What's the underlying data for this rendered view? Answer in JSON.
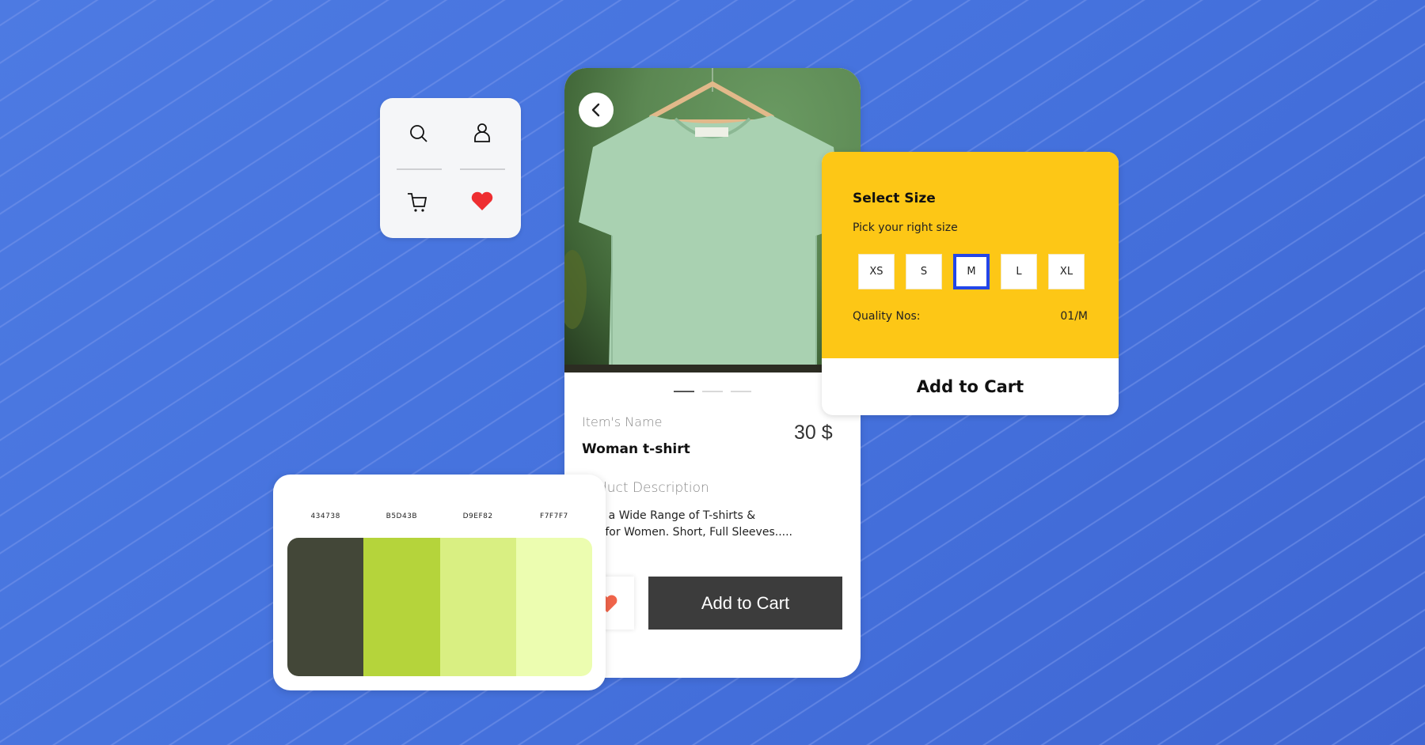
{
  "icon_card": {
    "icons": [
      {
        "name": "search-icon"
      },
      {
        "name": "user-icon"
      },
      {
        "name": "cart-icon"
      },
      {
        "name": "heart-icon",
        "color": "#ee2e31"
      }
    ]
  },
  "product_card": {
    "carousel": {
      "count": 3,
      "active": 1
    },
    "item_label": "Item's Name",
    "item_name": "Woman t-shirt",
    "price": "30 $",
    "description_label": "Product Description",
    "description_line1": "Shop a Wide Range of T-shirts &",
    "description_line2": "Tops for Women. Short, Full Sleeves.....",
    "favorite_color": "#f0644a",
    "add_to_cart": "Add to Cart"
  },
  "size_card": {
    "title": "Select Size",
    "subtitle": "Pick your right size",
    "sizes": [
      "XS",
      "S",
      "M",
      "L",
      "XL"
    ],
    "selected": "M",
    "quality_label": "Quality Nos:",
    "quality_value": "01/M",
    "add_to_cart": "Add to Cart",
    "accent": "#fdc716",
    "selected_color": "#2346e8"
  },
  "palette": {
    "colors": [
      {
        "label": "434738",
        "hex": "#434738"
      },
      {
        "label": "B5D43B",
        "hex": "#b5d43b"
      },
      {
        "label": "D9EF82",
        "hex": "#d9ef82"
      },
      {
        "label": "F7F7F7",
        "hex": "#ecfdb0"
      }
    ]
  }
}
